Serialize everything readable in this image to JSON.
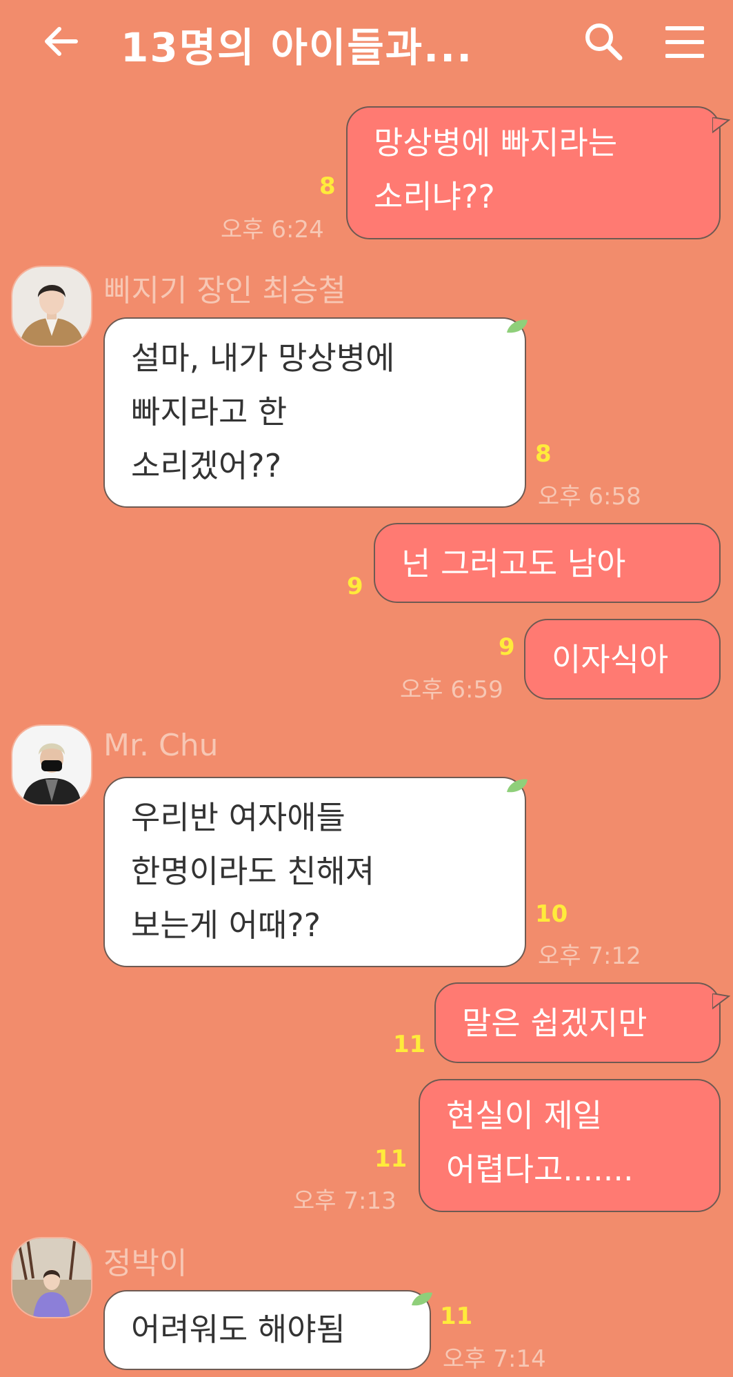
{
  "header": {
    "title": "13명의 아이들과...",
    "back_icon": "arrow-left-icon",
    "search_icon": "search-icon",
    "menu_icon": "hamburger-menu-icon"
  },
  "colors": {
    "background": "#f28c6c",
    "outgoing_bubble": "#ff7a72",
    "incoming_bubble": "#ffffff",
    "read_count": "#ffeb3b",
    "leaf": "#8fcf7a"
  },
  "messages": [
    {
      "text": "망상병에 빠지라는\n소리냐??",
      "read": "8",
      "time": "오후 6:24"
    },
    {
      "sender": "삐지기 장인 최승철",
      "text": "설마, 내가 망상병에\n빠지라고 한\n소리겠어??",
      "read": "8",
      "time": "오후 6:58"
    },
    {
      "text": "넌 그러고도 남아",
      "read": "9"
    },
    {
      "text": "이자식아",
      "read": "9",
      "time": "오후 6:59"
    },
    {
      "sender": "Mr. Chu",
      "text": "우리반 여자애들\n한명이라도 친해져\n보는게 어때??",
      "read": "10",
      "time": "오후 7:12"
    },
    {
      "text": "말은 쉽겠지만",
      "read": "11"
    },
    {
      "text": "현실이 제일\n어렵다고.......",
      "read": "11",
      "time": "오후 7:13"
    },
    {
      "sender": "정박이",
      "text": "어려워도 해야됨",
      "read": "11",
      "time": "오후 7:14"
    }
  ]
}
